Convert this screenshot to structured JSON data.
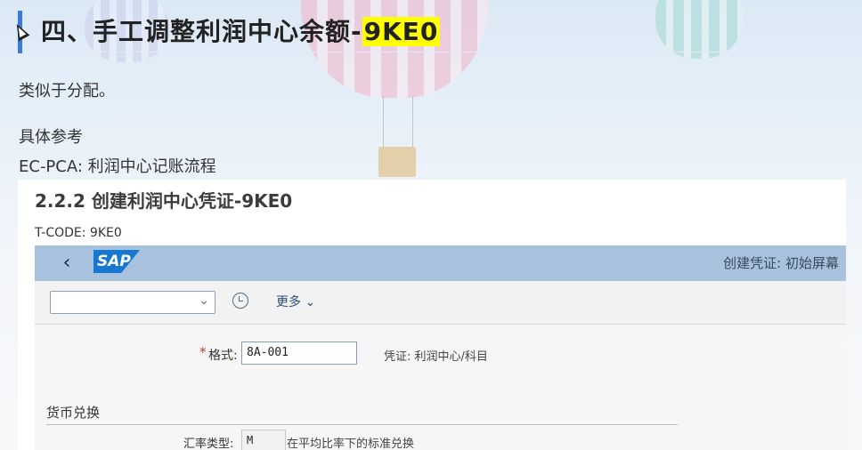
{
  "article": {
    "heading_prefix": "四、手工调整利润中心余额-",
    "heading_code": "9KE0",
    "intro": "类似于分配。",
    "ref_label": "具体参考",
    "ref_link": "EC-PCA: 利润中心记账流程"
  },
  "embedded_doc": {
    "title": "2.2.2 创建利润中心凭证-9KE0",
    "tcode": "T-CODE: 9KE0"
  },
  "sap": {
    "logo": "SAP",
    "screen_title": "创建凭证: 初始屏幕",
    "command_field_value": "",
    "more_label": "更多",
    "format_label": "格式:",
    "format_value": "8A-001",
    "format_description": "凭证: 利润中心/科目",
    "currency_section": "货币兑换",
    "rate_type_label": "汇率类型:",
    "rate_type_value": "M",
    "rate_type_description": "在平均比率下的标准兑换"
  },
  "colors": {
    "heading_accent": "#3a7bd5",
    "highlight": "#ffff00",
    "sap_header": "#a8c2dd",
    "sap_logo": "#1677d2",
    "required": "#c0392b"
  }
}
